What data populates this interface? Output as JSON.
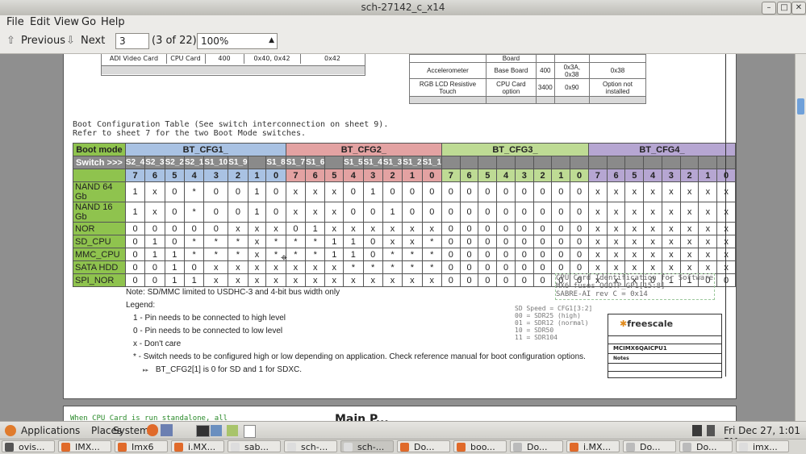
{
  "window": {
    "title": "sch-27142_c_x14",
    "controls": [
      "–",
      "□",
      "✕"
    ]
  },
  "menu": [
    "File",
    "Edit",
    "View",
    "Go",
    "Help"
  ],
  "toolbar": {
    "previous": "Previous",
    "next": "Next",
    "page_value": "3",
    "page_count": "(3 of 22)",
    "zoom": "100%"
  },
  "doc": {
    "top_left_row": [
      "ADI Video Card",
      "CPU Card",
      "400",
      "0x40, 0x42",
      "0x42"
    ],
    "top_right_rows": [
      [
        "",
        "Board",
        "",
        "",
        ""
      ],
      [
        "Accelerometer",
        "Base Board",
        "400",
        "0x3A, 0x38",
        "0x38"
      ],
      [
        "RGB LCD Resistive Touch",
        "CPU Card option",
        "3400",
        "0x90",
        "Option not installed"
      ]
    ],
    "heading1": "Boot Configuration Table (See switch interconnection on sheet 9).",
    "heading2": "Refer to sheet 7 for the two Boot Mode switches.",
    "boot_mode_label": "Boot mode",
    "groups": [
      "BT_CFG1_",
      "BT_CFG2_",
      "BT_CFG3_",
      "BT_CFG4_"
    ],
    "switch_label": "Switch >>>",
    "switches": [
      "S2_4",
      "S2_3",
      "S2_2",
      "S2_1",
      "S1_10",
      "S1_9",
      "",
      "S1_8",
      "S1_7",
      "S1_6",
      "",
      "S1_5",
      "S1_4",
      "S1_3",
      "S1_2",
      "S1_1",
      "",
      "",
      "",
      "",
      "",
      "",
      "",
      "",
      "",
      "",
      "",
      "",
      "",
      "",
      "",
      ""
    ],
    "bits": [
      "7",
      "6",
      "5",
      "4",
      "3",
      "2",
      "1",
      "0",
      "7",
      "6",
      "5",
      "4",
      "3",
      "2",
      "1",
      "0",
      "7",
      "6",
      "5",
      "4",
      "3",
      "2",
      "1",
      "0",
      "7",
      "6",
      "5",
      "4",
      "3",
      "2",
      "1",
      "0"
    ],
    "rows": [
      {
        "mode": "NAND 64 Gb",
        "vals": [
          "1",
          "x",
          "0",
          "*",
          "0",
          "0",
          "1",
          "0",
          "x",
          "x",
          "x",
          "0",
          "1",
          "0",
          "0",
          "0",
          "0",
          "0",
          "0",
          "0",
          "0",
          "0",
          "0",
          "0",
          "x",
          "x",
          "x",
          "x",
          "x",
          "x",
          "x",
          "x"
        ]
      },
      {
        "mode": "NAND 16 Gb",
        "vals": [
          "1",
          "x",
          "0",
          "*",
          "0",
          "0",
          "1",
          "0",
          "x",
          "x",
          "x",
          "0",
          "0",
          "1",
          "0",
          "0",
          "0",
          "0",
          "0",
          "0",
          "0",
          "0",
          "0",
          "0",
          "x",
          "x",
          "x",
          "x",
          "x",
          "x",
          "x",
          "x"
        ]
      },
      {
        "mode": "NOR",
        "vals": [
          "0",
          "0",
          "0",
          "0",
          "0",
          "x",
          "x",
          "x",
          "0",
          "1",
          "x",
          "x",
          "x",
          "x",
          "x",
          "x",
          "0",
          "0",
          "0",
          "0",
          "0",
          "0",
          "0",
          "0",
          "x",
          "x",
          "x",
          "x",
          "x",
          "x",
          "x",
          "x"
        ]
      },
      {
        "mode": "SD_CPU",
        "vals": [
          "0",
          "1",
          "0",
          "*",
          "*",
          "*",
          "x",
          "*",
          "*",
          "*",
          "1",
          "1",
          "0",
          "x",
          "x",
          "*",
          "0",
          "0",
          "0",
          "0",
          "0",
          "0",
          "0",
          "0",
          "x",
          "x",
          "x",
          "x",
          "x",
          "x",
          "x",
          "x"
        ]
      },
      {
        "mode": "MMC_CPU",
        "vals": [
          "0",
          "1",
          "1",
          "*",
          "*",
          "*",
          "x",
          "*",
          "*",
          "*",
          "1",
          "1",
          "0",
          "*",
          "*",
          "*",
          "0",
          "0",
          "0",
          "0",
          "0",
          "0",
          "0",
          "0",
          "x",
          "x",
          "x",
          "x",
          "x",
          "x",
          "x",
          "x"
        ]
      },
      {
        "mode": "SATA HDD",
        "vals": [
          "0",
          "0",
          "1",
          "0",
          "x",
          "x",
          "x",
          "x",
          "x",
          "x",
          "x",
          "*",
          "*",
          "*",
          "*",
          "*",
          "0",
          "0",
          "0",
          "0",
          "0",
          "0",
          "0",
          "0",
          "x",
          "x",
          "x",
          "x",
          "x",
          "x",
          "x",
          "x"
        ]
      },
      {
        "mode": "SPI_NOR",
        "vals": [
          "0",
          "0",
          "1",
          "1",
          "x",
          "x",
          "x",
          "x",
          "x",
          "x",
          "x",
          "x",
          "x",
          "x",
          "x",
          "x",
          "0",
          "0",
          "0",
          "0",
          "0",
          "0",
          "0",
          "0",
          "x",
          "x",
          "x",
          "0",
          "1",
          "1",
          "0",
          "0"
        ]
      }
    ],
    "note": "Note: SD/MMC limited to USDHC-3 and 4-bit bus width only",
    "legend_title": "Legend:",
    "legend": [
      "1 - Pin needs to be connected to high level",
      "0 - Pin needs to be connected to low level",
      "x - Don't care",
      "* - Switch needs to be configured high or low depending on application. Check reference manual for boot configuration options."
    ],
    "legend_note": "BT_CFG2[1] is 0 for SD and 1 for SDXC.",
    "cpu_card_id": [
      "CPU Card Identification for Software",
      "MX6 fuses OCOTP_GP1[15:8]",
      "SABRE-AI rev C = 0x14"
    ],
    "sd_speed": [
      "SD Speed = CFG1[3:2]",
      "00 = SDR25 (high)",
      "01 = SDR12 (normal)",
      "10 = SDR50",
      "11 = SDR104"
    ],
    "freescale": "freescale",
    "tb_title": "MCIMX6QAICPU1",
    "tb_page_title": "Notes",
    "page2_text": "When CPU Card is run standalone, all",
    "page2_heading": "Main P..."
  },
  "panel": {
    "applications": "Applications",
    "places": "Places",
    "system": "System",
    "clock": "Fri Dec 27,  1:01 PM"
  },
  "tasks": [
    "ovis...",
    "IMX...",
    "Imx6",
    "i.MX...",
    "sab...",
    "sch-...",
    "sch-...",
    "Do...",
    "boo...",
    "Do...",
    "i.MX...",
    "Do...",
    "Do...",
    "imx..."
  ],
  "colors": {
    "boot_mode": "#8fc34e",
    "cfg1": "#a9c2e3",
    "cfg2": "#e3a2a2",
    "cfg3": "#bedb94",
    "cfg4": "#b6a6d2",
    "switch_bg": "#8a8a8a"
  }
}
